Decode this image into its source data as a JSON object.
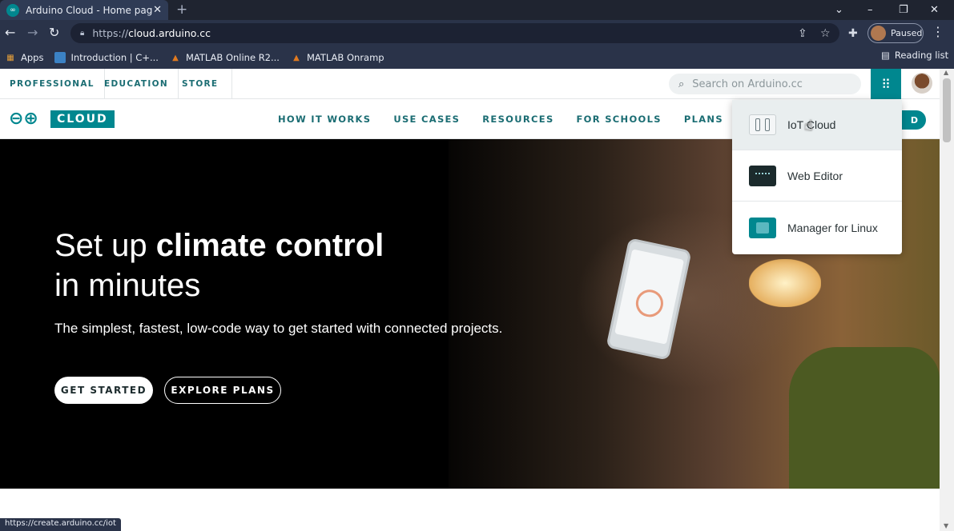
{
  "browser": {
    "tab_title": "Arduino Cloud - Home page",
    "tab_close": "✕",
    "new_tab": "+",
    "window_controls": [
      "⌄",
      "–",
      "❐",
      "✕"
    ],
    "url_scheme": "https://",
    "url_host": "cloud.arduino.cc",
    "profile_status": "Paused",
    "bookmarks": [
      {
        "label": "Apps",
        "icon": "apps-grid-icon"
      },
      {
        "label": "Introduction | C+...",
        "icon": "page-icon"
      },
      {
        "label": "MATLAB Online R2...",
        "icon": "matlab-icon"
      },
      {
        "label": "MATLAB Onramp",
        "icon": "matlab-icon"
      }
    ],
    "reading_list": "Reading list",
    "status_url": "https://create.arduino.cc/iot"
  },
  "topnav": {
    "links": [
      "PROFESSIONAL",
      "EDUCATION",
      "STORE"
    ],
    "search_placeholder": "Search on Arduino.cc"
  },
  "mainnav": {
    "logo_text": "CLOUD",
    "menu": [
      "HOW IT WORKS",
      "USE CASES",
      "RESOURCES",
      "FOR SCHOOLS",
      "PLANS"
    ],
    "partial_button": "D"
  },
  "hero": {
    "title_part1": "Set up ",
    "title_bold": "climate control",
    "title_part2": "in minutes",
    "subtitle": "The simplest, fastest, low-code way to get started with connected projects.",
    "primary_button": "GET STARTED",
    "secondary_button": "EXPLORE PLANS"
  },
  "apps_dropdown": {
    "items": [
      {
        "label": "IoT Cloud",
        "icon": "iot-cloud-icon",
        "active": true
      },
      {
        "label": "Web Editor",
        "icon": "web-editor-icon",
        "active": false
      },
      {
        "label": "Manager for Linux",
        "icon": "manager-linux-icon",
        "active": false
      }
    ]
  },
  "colors": {
    "brand": "#00878f",
    "nav_text": "#1b6d73",
    "chrome_dark": "#2a3349"
  }
}
